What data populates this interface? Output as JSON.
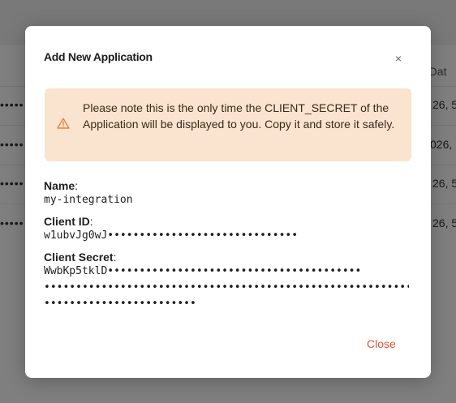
{
  "background": {
    "column_header": "n Dat",
    "rows": [
      {
        "masked": "•••••",
        "date": "26, 5"
      },
      {
        "masked": "•••••",
        "date": "026, 1"
      },
      {
        "masked": "•••••",
        "date": "26, 5"
      },
      {
        "masked": "•••••",
        "date": "26, 5"
      }
    ]
  },
  "modal": {
    "title": "Add New Application",
    "close_icon": "×",
    "alert": {
      "icon": "warning-triangle",
      "text": "Please note this is the only time the CLIENT_SECRET of the Application will be displayed to you. Copy it and store it safely."
    },
    "fields": {
      "name_label": "Name",
      "name_value": "my-integration",
      "client_id_label": "Client ID",
      "client_id_value": "w1ubvJg0wJ••••••••••••••••••••••••••••••",
      "client_secret_label": "Client Secret",
      "client_secret_line1": "WwbKp5tklD••••••••••••••••••••••••••••••••••••••••",
      "client_secret_line2": "••••••••••••••••••••••••••••••••••••••••••••••••••••••••••••",
      "client_secret_line3": "••••••••••••••••••••••••"
    },
    "close_label": "Close"
  },
  "colors": {
    "alert_bg": "#fae3cf",
    "alert_icon": "#e8833a",
    "close_text": "#e0533d"
  }
}
